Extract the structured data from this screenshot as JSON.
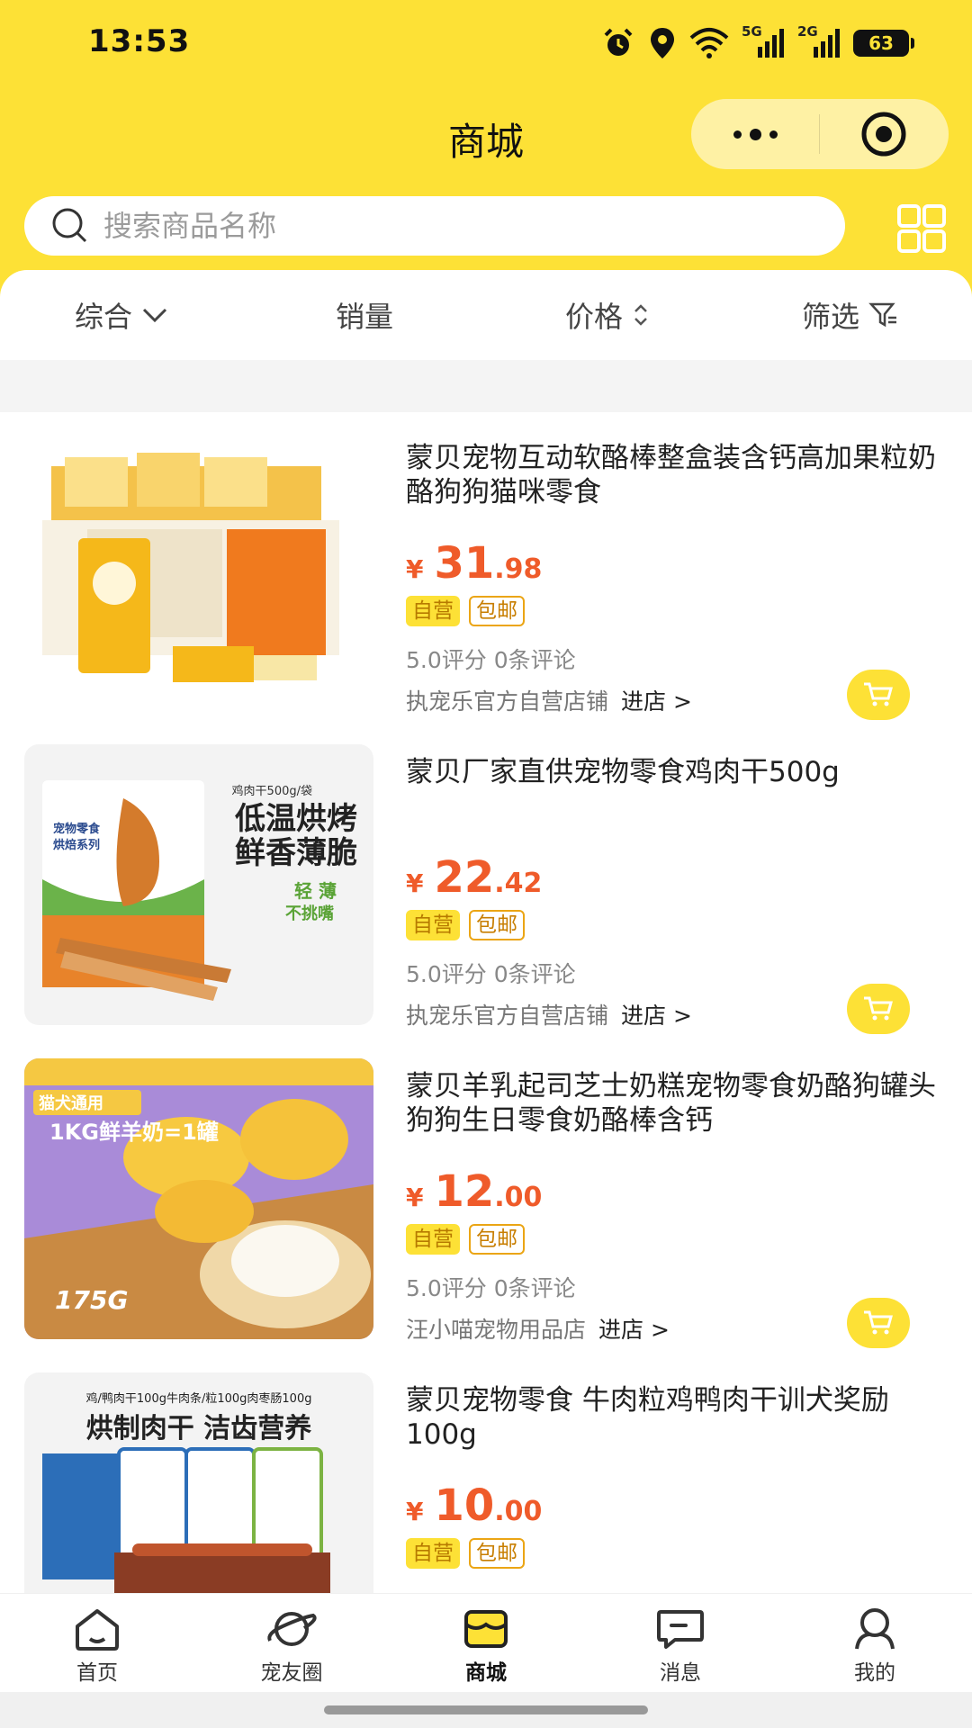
{
  "status_bar": {
    "time": "13:53",
    "battery": "63",
    "network_1": "5G",
    "network_2": "2G"
  },
  "header": {
    "title": "商城",
    "search_placeholder": "搜索商品名称"
  },
  "sort_bar": {
    "items": [
      {
        "label": "综合"
      },
      {
        "label": "销量"
      },
      {
        "label": "价格"
      },
      {
        "label": "筛选"
      }
    ]
  },
  "products": [
    {
      "title": "蒙贝宠物互动软酪棒整盒装含钙高加果粒奶酪狗狗猫咪零食",
      "currency": "¥",
      "price_int": "31",
      "price_dec": ".98",
      "tag_self": "自营",
      "tag_free": "包邮",
      "rating": "5.0评分 0条评论",
      "shop": "执宠乐官方自营店铺",
      "enter": "进店 >"
    },
    {
      "title": "蒙贝厂家直供宠物零食鸡肉干500g",
      "currency": "¥",
      "price_int": "22",
      "price_dec": ".42",
      "tag_self": "自营",
      "tag_free": "包邮",
      "rating": "5.0评分 0条评论",
      "shop": "执宠乐官方自营店铺",
      "enter": "进店 >",
      "image_text": {
        "line1": "鸡肉干500g/袋",
        "line2": "低温烘烤",
        "line3": "鲜香薄脆",
        "line4": "宠物零食",
        "line5": "烘焙系列",
        "line6": "轻 薄",
        "line7": "不挑嘴"
      }
    },
    {
      "title": "蒙贝羊乳起司芝士奶糕宠物零食奶酪狗罐头狗狗生日零食奶酪棒含钙",
      "currency": "¥",
      "price_int": "12",
      "price_dec": ".00",
      "tag_self": "自营",
      "tag_free": "包邮",
      "rating": "5.0评分 0条评论",
      "shop": "汪小喵宠物用品店",
      "enter": "进店 >",
      "image_text": {
        "line1": "猫犬通用",
        "line2": "1KG鲜羊奶=1罐",
        "line3": "175G"
      }
    },
    {
      "title": "蒙贝宠物零食 牛肉粒鸡鸭肉干训犬奖励100g",
      "currency": "¥",
      "price_int": "10",
      "price_dec": ".00",
      "tag_self": "自营",
      "tag_free": "包邮",
      "image_text": {
        "line1": "鸡/鸭肉干100g牛肉条/粒100g肉枣肠100g",
        "line2": "烘制肉干 洁齿营养"
      }
    }
  ],
  "tabbar": {
    "items": [
      {
        "label": "首页",
        "icon": "home-icon"
      },
      {
        "label": "宠友圈",
        "icon": "planet-icon"
      },
      {
        "label": "商城",
        "icon": "shop-icon"
      },
      {
        "label": "消息",
        "icon": "message-icon"
      },
      {
        "label": "我的",
        "icon": "user-icon"
      }
    ]
  },
  "colors": {
    "brand_yellow": "#fde136",
    "price_orange": "#ef5b2a"
  }
}
